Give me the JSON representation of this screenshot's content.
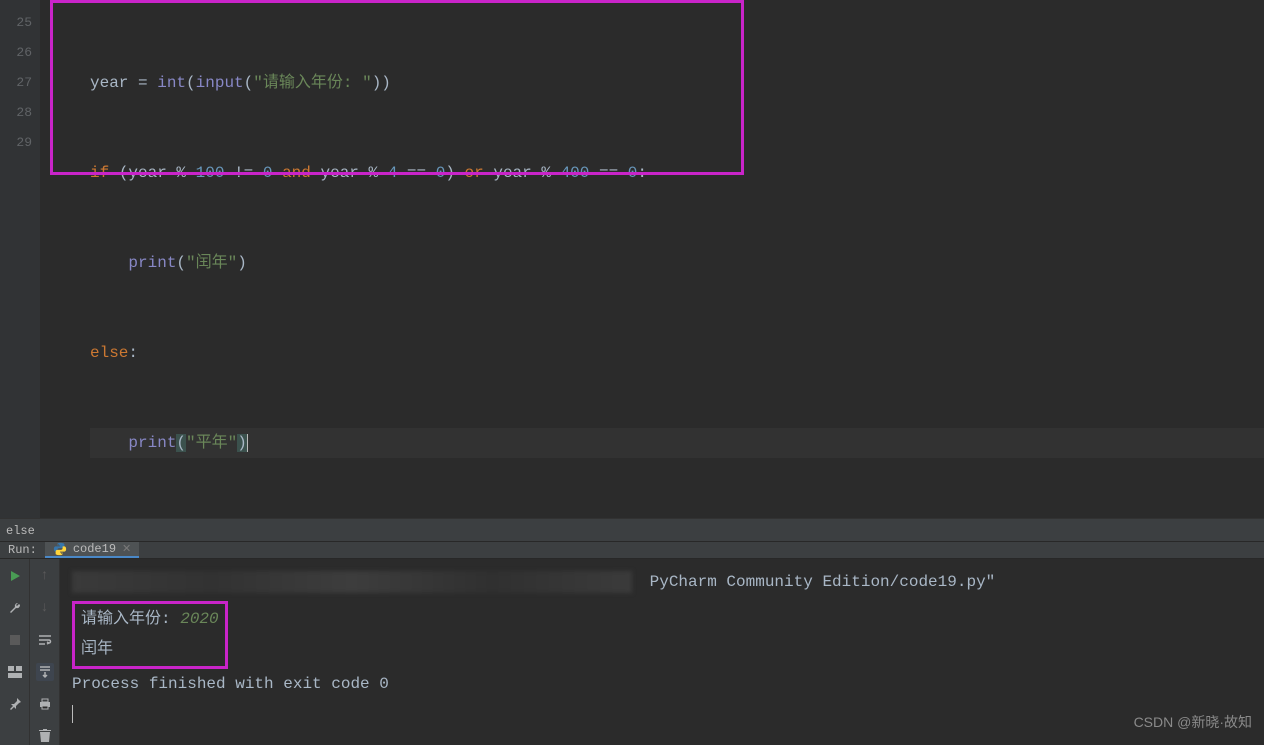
{
  "editor": {
    "line_numbers": [
      "25",
      "26",
      "27",
      "28",
      "29"
    ],
    "tokens": {
      "l25": {
        "year": "year",
        "eq": " = ",
        "int": "int",
        "lp": "(",
        "input": "input",
        "lp2": "(",
        "s": "\"请输入年份: \"",
        "rp2": ")",
        "rp": ")"
      },
      "l26": {
        "if": "if",
        "sp": " ",
        "lp": "(",
        "year1": "year",
        "pct1": " % ",
        "h": "100",
        "ne": " != ",
        "z": "0",
        "and": " and ",
        "year2": "year",
        "pct2": " % ",
        "four": "4",
        "eqeq": " == ",
        "z2": "0",
        "rp": ")",
        "or": " or ",
        "year3": "year",
        "pct3": " % ",
        "fh": "400",
        "eqeq2": " == ",
        "z3": "0",
        "colon": ":"
      },
      "l27": {
        "indent": "    ",
        "print": "print",
        "lp": "(",
        "s": "\"闰年\"",
        "rp": ")"
      },
      "l28": {
        "else": "else",
        "colon": ":"
      },
      "l29": {
        "indent": "    ",
        "print": "print",
        "lp": "(",
        "s": "\"平年\"",
        "rp": ")"
      }
    }
  },
  "crumb": "else",
  "run": {
    "label": "Run:",
    "tab": "code19"
  },
  "console": {
    "path_suffix": "PyCharm Community Edition/code19.py\"",
    "prompt": "请输入年份: ",
    "input_value": "2020",
    "result": "闰年",
    "blank_gap": "",
    "process_msg": "Process finished with exit code 0"
  },
  "watermark": "CSDN @新晓·故知"
}
